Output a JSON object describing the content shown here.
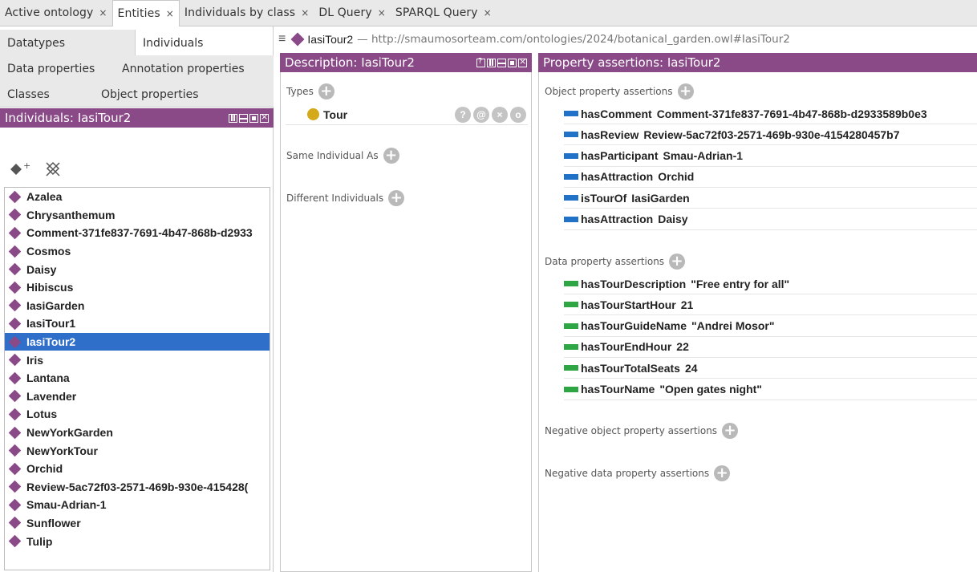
{
  "top_tabs": [
    {
      "label": "Active ontology"
    },
    {
      "label": "Entities"
    },
    {
      "label": "Individuals by class"
    },
    {
      "label": "DL Query"
    },
    {
      "label": "SPARQL Query"
    }
  ],
  "tab_close_glyph": "×",
  "left_tabs": {
    "datatypes": "Datatypes",
    "individuals": "Individuals",
    "data_properties": "Data properties",
    "annotation_properties": "Annotation properties",
    "classes": "Classes",
    "object_properties": "Object properties"
  },
  "individuals_view": {
    "title": "Individuals: IasiTour2",
    "items": [
      "Azalea",
      "Chrysanthemum",
      "Comment-371fe837-7691-4b47-868b-d2933",
      "Cosmos",
      "Daisy",
      "Hibiscus",
      "IasiGarden",
      "IasiTour1",
      "IasiTour2",
      "Iris",
      "Lantana",
      "Lavender",
      "Lotus",
      "NewYorkGarden",
      "NewYorkTour",
      "Orchid",
      "Review-5ac72f03-2571-469b-930e-415428(",
      "Smau-Adrian-1",
      "Sunflower",
      "Tulip"
    ],
    "selected": "IasiTour2"
  },
  "entity_bar": {
    "name": "IasiTour2",
    "iri": "— http://smaumosorteam.com/ontologies/2024/botanical_garden.owl#IasiTour2"
  },
  "description": {
    "title": "Description: IasiTour2",
    "types_label": "Types",
    "type": "Tour",
    "same_label": "Same Individual As",
    "different_label": "Different Individuals"
  },
  "property_assertions": {
    "title": "Property assertions: IasiTour2",
    "object_label": "Object property assertions",
    "object": [
      {
        "prop": "hasComment",
        "val": "Comment-371fe837-7691-4b47-868b-d2933589b0e3"
      },
      {
        "prop": "hasReview",
        "val": "Review-5ac72f03-2571-469b-930e-4154280457b7"
      },
      {
        "prop": "hasParticipant",
        "val": "Smau-Adrian-1"
      },
      {
        "prop": "hasAttraction",
        "val": "Orchid"
      },
      {
        "prop": "isTourOf",
        "val": "IasiGarden"
      },
      {
        "prop": "hasAttraction",
        "val": "Daisy"
      }
    ],
    "data_label": "Data property assertions",
    "data": [
      {
        "prop": "hasTourDescription",
        "val": "\"Free entry for all\""
      },
      {
        "prop": "hasTourStartHour",
        "val": "21"
      },
      {
        "prop": "hasTourGuideName",
        "val": "\"Andrei Mosor\""
      },
      {
        "prop": "hasTourEndHour",
        "val": "22"
      },
      {
        "prop": "hasTourTotalSeats",
        "val": "24"
      },
      {
        "prop": "hasTourName",
        "val": "\"Open gates night\""
      }
    ],
    "neg_object_label": "Negative object property assertions",
    "neg_data_label": "Negative data property assertions"
  },
  "colors": {
    "view_header": "#8a4a87",
    "selection": "#2f6fc9",
    "object_prop": "#1f72c8",
    "data_prop": "#2ea644",
    "type_circle": "#d4a91a"
  }
}
